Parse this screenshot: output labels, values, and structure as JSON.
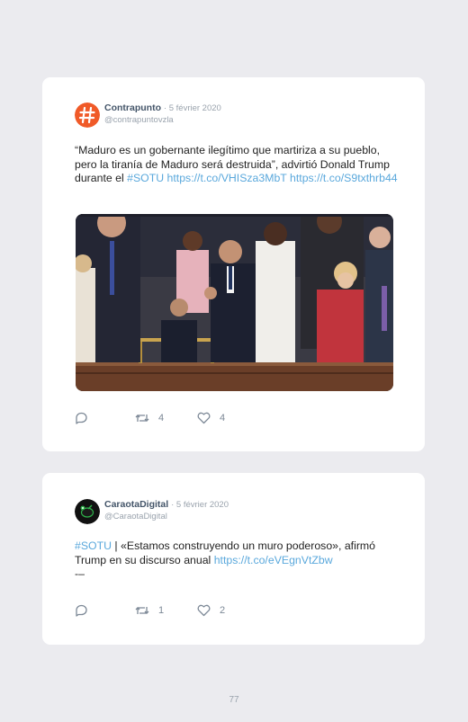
{
  "tweets": [
    {
      "author": "Contrapunto",
      "date": "· 5 février 2020",
      "handle": "@contrapuntovzla",
      "text_plain": "“Maduro es un gobernante ilegítimo que martiriza a su pueblo, pero la tiranía de Maduro será destruida”, advirtió Donald Trump durante el ",
      "hashtag": "#SOTU",
      "link1": "https://t.co/VHISza3MbT",
      "link2": "https://t.co/S9txthrb44",
      "retweets": "4",
      "likes": "4",
      "avatar_icon": "hash-logo-icon",
      "avatar_color": "#f05a28"
    },
    {
      "author": "CaraotaDigital",
      "date": "· 5 février 2020",
      "handle": "@CaraotaDigital",
      "hashtag": "#SOTU",
      "text_plain": " | «Estamos construyendo un muro poderoso», afirmó Trump en su discurso anual ",
      "link1": "https://t.co/eVEgnVtZbw",
      "trailing": "-–",
      "retweets": "1",
      "likes": "2",
      "avatar_icon": "caraota-logo-icon",
      "avatar_color": "#111111"
    }
  ],
  "icons": {
    "reply": "reply-icon",
    "retweet": "retweet-icon",
    "like": "heart-icon"
  },
  "colors": {
    "link": "#5aa8dc",
    "card": "#ffffff",
    "page": "#ebebef",
    "name": "#445569"
  },
  "page_number": "77"
}
